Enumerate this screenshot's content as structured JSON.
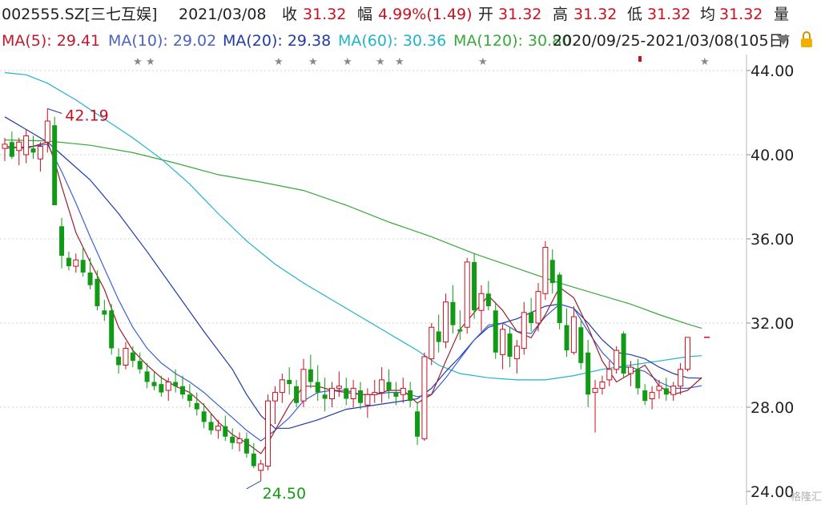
{
  "header": {
    "code": "002555.SZ[三七互娱]",
    "date": "2021/03/08",
    "close_label": "收",
    "close_value": "31.32",
    "change_label": "幅",
    "change_value": "4.99%(1.49)",
    "open_label": "开",
    "open_value": "31.32",
    "high_label": "高",
    "high_value": "31.32",
    "low_label": "低",
    "low_value": "31.32",
    "avg_label": "均",
    "avg_value": "31.32",
    "volume_label": "量"
  },
  "ma_bar": {
    "ma5": "MA(5): 29.41",
    "ma10": "MA(10): 29.02",
    "ma20": "MA(20): 29.38",
    "ma60": "MA(60): 30.36",
    "ma120": "MA(120): 30.80",
    "range": "2020/09/25-2021/03/08(105日)",
    "dropdown_icon": "triangle-down-icon",
    "lock_icon": "lock-icon"
  },
  "colors": {
    "up": "#c8101e",
    "down": "#119a15",
    "ma5": "#9b1f2b",
    "ma10": "#1f3ba8",
    "ma20": "#3c5fd6",
    "ma60": "#22b3c9",
    "ma120": "#38a83a",
    "grid": "#d0d0d0"
  },
  "watermark": "格隆汇",
  "chart_data": {
    "type": "candlestick",
    "title": "",
    "ylim": [
      24,
      44
    ],
    "y_ticks": [
      "44.00",
      "40.00",
      "36.00",
      "32.00",
      "28.00",
      "24.00"
    ],
    "annotations": {
      "high": "42.19",
      "low": "24.50"
    },
    "candles": [
      [
        40.3,
        40.8,
        39.7,
        40.5
      ],
      [
        40.6,
        41.1,
        39.8,
        39.9
      ],
      [
        40.2,
        40.8,
        39.5,
        40.6
      ],
      [
        40.0,
        41.2,
        39.6,
        40.9
      ],
      [
        40.3,
        40.9,
        39.8,
        40.1
      ],
      [
        39.8,
        40.6,
        39.2,
        40.4
      ],
      [
        40.6,
        42.19,
        40.1,
        41.6
      ],
      [
        41.4,
        41.8,
        37.8,
        37.6
      ],
      [
        36.6,
        37.0,
        34.6,
        35.2
      ],
      [
        35.1,
        35.4,
        34.5,
        34.7
      ],
      [
        34.7,
        35.3,
        34.4,
        35.0
      ],
      [
        35.0,
        35.6,
        34.2,
        34.4
      ],
      [
        34.4,
        35.1,
        33.6,
        33.8
      ],
      [
        34.1,
        34.5,
        32.6,
        32.8
      ],
      [
        32.6,
        33.1,
        32.1,
        32.4
      ],
      [
        32.6,
        32.9,
        30.5,
        30.8
      ],
      [
        30.4,
        30.8,
        29.6,
        30.0
      ],
      [
        30.0,
        31.1,
        29.8,
        30.8
      ],
      [
        30.6,
        30.9,
        29.9,
        30.2
      ],
      [
        30.2,
        30.6,
        29.6,
        29.8
      ],
      [
        29.7,
        30.1,
        28.9,
        29.2
      ],
      [
        29.2,
        29.7,
        28.8,
        29.0
      ],
      [
        29.1,
        29.5,
        28.5,
        28.7
      ],
      [
        28.8,
        29.4,
        28.3,
        29.2
      ],
      [
        29.2,
        29.8,
        28.7,
        29.0
      ],
      [
        29.0,
        29.5,
        28.4,
        28.6
      ],
      [
        28.6,
        29.1,
        28.0,
        28.3
      ],
      [
        28.2,
        28.7,
        27.6,
        27.9
      ],
      [
        27.8,
        28.2,
        27.0,
        27.3
      ],
      [
        27.3,
        27.7,
        26.7,
        26.9
      ],
      [
        26.9,
        27.4,
        26.5,
        27.1
      ],
      [
        27.1,
        27.6,
        26.4,
        26.6
      ],
      [
        26.6,
        27.0,
        26.0,
        26.3
      ],
      [
        26.3,
        26.8,
        25.9,
        26.5
      ],
      [
        26.5,
        26.8,
        25.6,
        25.8
      ],
      [
        25.8,
        26.3,
        25.1,
        25.2
      ],
      [
        25.0,
        25.5,
        24.5,
        25.3
      ],
      [
        25.2,
        28.6,
        25.0,
        28.3
      ],
      [
        28.3,
        29.0,
        27.2,
        28.7
      ],
      [
        28.7,
        29.6,
        28.2,
        29.3
      ],
      [
        29.3,
        29.9,
        28.6,
        29.1
      ],
      [
        29.0,
        29.3,
        28.0,
        28.2
      ],
      [
        28.3,
        30.3,
        28.0,
        29.8
      ],
      [
        29.8,
        30.5,
        28.9,
        29.2
      ],
      [
        29.2,
        30.0,
        28.3,
        28.7
      ],
      [
        28.6,
        29.4,
        27.8,
        28.4
      ],
      [
        28.4,
        29.2,
        28.0,
        28.9
      ],
      [
        28.9,
        29.7,
        28.5,
        29.0
      ],
      [
        28.9,
        29.4,
        28.1,
        28.4
      ],
      [
        28.4,
        29.3,
        28.0,
        28.9
      ],
      [
        28.8,
        29.2,
        27.9,
        28.2
      ],
      [
        28.1,
        28.9,
        27.5,
        28.6
      ],
      [
        28.6,
        29.3,
        28.2,
        28.7
      ],
      [
        28.7,
        29.9,
        28.2,
        29.3
      ],
      [
        29.2,
        29.8,
        28.4,
        28.8
      ],
      [
        28.7,
        29.2,
        28.1,
        28.5
      ],
      [
        28.6,
        29.4,
        28.2,
        28.9
      ],
      [
        28.8,
        29.2,
        28.0,
        28.3
      ],
      [
        27.8,
        28.2,
        26.2,
        26.6
      ],
      [
        26.5,
        30.6,
        26.4,
        30.4
      ],
      [
        30.3,
        32.0,
        30.0,
        31.8
      ],
      [
        31.6,
        32.4,
        30.6,
        31.1
      ],
      [
        31.1,
        33.4,
        30.8,
        33.0
      ],
      [
        33.0,
        33.8,
        31.5,
        31.9
      ],
      [
        31.7,
        32.6,
        31.2,
        31.6
      ],
      [
        31.8,
        35.1,
        31.5,
        34.9
      ],
      [
        34.9,
        35.3,
        32.2,
        32.6
      ],
      [
        32.6,
        33.8,
        31.6,
        33.4
      ],
      [
        33.4,
        34.0,
        32.6,
        32.8
      ],
      [
        32.6,
        33.0,
        30.3,
        30.6
      ],
      [
        30.5,
        32.0,
        29.8,
        31.7
      ],
      [
        31.5,
        31.8,
        29.9,
        30.4
      ],
      [
        30.3,
        31.2,
        29.6,
        30.9
      ],
      [
        30.8,
        33.0,
        30.5,
        32.5
      ],
      [
        32.5,
        33.2,
        31.6,
        32.0
      ],
      [
        32.0,
        33.9,
        31.6,
        33.5
      ],
      [
        33.4,
        35.9,
        33.1,
        35.6
      ],
      [
        35.0,
        35.5,
        33.4,
        33.9
      ],
      [
        34.3,
        34.4,
        31.7,
        32.0
      ],
      [
        31.9,
        32.7,
        30.4,
        30.7
      ],
      [
        30.6,
        32.8,
        30.5,
        32.3
      ],
      [
        31.8,
        32.1,
        29.8,
        30.1
      ],
      [
        30.6,
        31.2,
        28.0,
        28.6
      ],
      [
        28.7,
        29.3,
        26.8,
        28.9
      ],
      [
        28.9,
        29.5,
        28.6,
        29.2
      ],
      [
        29.3,
        30.2,
        29.0,
        29.8
      ],
      [
        29.8,
        30.9,
        29.6,
        30.7
      ],
      [
        31.5,
        31.6,
        29.4,
        29.6
      ],
      [
        29.6,
        30.2,
        29.0,
        29.9
      ],
      [
        29.8,
        30.3,
        28.6,
        28.9
      ],
      [
        28.8,
        29.1,
        28.1,
        28.3
      ],
      [
        28.4,
        29.0,
        27.9,
        28.7
      ],
      [
        28.8,
        29.3,
        28.4,
        29.0
      ],
      [
        28.9,
        29.4,
        28.3,
        28.6
      ],
      [
        28.6,
        29.2,
        28.3,
        29.0
      ],
      [
        29.0,
        30.1,
        28.6,
        29.8
      ],
      [
        29.8,
        31.32,
        29.7,
        31.32
      ]
    ],
    "ma120_last": 31.32,
    "ma_series": {
      "MA60": [
        [
          0,
          43.9
        ],
        [
          3,
          43.8
        ],
        [
          6,
          43.4
        ],
        [
          10,
          42.6
        ],
        [
          14,
          41.7
        ],
        [
          18,
          40.8
        ],
        [
          22,
          39.8
        ],
        [
          26,
          38.6
        ],
        [
          30,
          37.2
        ],
        [
          34,
          35.9
        ],
        [
          38,
          34.8
        ],
        [
          42,
          33.9
        ],
        [
          46,
          33.1
        ],
        [
          50,
          32.3
        ],
        [
          54,
          31.5
        ],
        [
          58,
          30.7
        ],
        [
          61,
          30.0
        ],
        [
          64,
          29.6
        ],
        [
          68,
          29.4
        ],
        [
          72,
          29.3
        ],
        [
          76,
          29.3
        ],
        [
          80,
          29.5
        ],
        [
          84,
          29.8
        ],
        [
          88,
          30.0
        ],
        [
          92,
          30.2
        ],
        [
          96,
          30.4
        ],
        [
          98,
          30.45
        ]
      ],
      "MA120": [
        [
          0,
          40.7
        ],
        [
          6,
          40.65
        ],
        [
          12,
          40.45
        ],
        [
          18,
          40.1
        ],
        [
          24,
          39.6
        ],
        [
          30,
          39.05
        ],
        [
          36,
          38.7
        ],
        [
          42,
          38.3
        ],
        [
          48,
          37.6
        ],
        [
          54,
          36.8
        ],
        [
          60,
          36.1
        ],
        [
          66,
          35.3
        ],
        [
          72,
          34.6
        ],
        [
          78,
          33.9
        ],
        [
          84,
          33.3
        ],
        [
          88,
          32.9
        ],
        [
          92,
          32.4
        ],
        [
          96,
          31.95
        ],
        [
          98,
          31.75
        ]
      ],
      "MA20": [
        [
          0,
          41.8
        ],
        [
          3,
          41.2
        ],
        [
          6,
          40.6
        ],
        [
          8,
          40.0
        ],
        [
          12,
          38.8
        ],
        [
          16,
          37.2
        ],
        [
          20,
          35.4
        ],
        [
          24,
          33.5
        ],
        [
          28,
          31.6
        ],
        [
          32,
          29.8
        ],
        [
          34,
          28.6
        ],
        [
          36,
          27.6
        ],
        [
          38,
          27.0
        ],
        [
          40,
          27.0
        ],
        [
          44,
          27.4
        ],
        [
          48,
          27.9
        ],
        [
          52,
          28.1
        ],
        [
          56,
          28.3
        ],
        [
          58,
          28.4
        ],
        [
          60,
          28.9
        ],
        [
          62,
          29.7
        ],
        [
          64,
          30.4
        ],
        [
          66,
          31.2
        ],
        [
          68,
          31.8
        ],
        [
          70,
          32.0
        ],
        [
          72,
          32.2
        ],
        [
          74,
          32.5
        ],
        [
          76,
          32.8
        ],
        [
          78,
          32.9
        ],
        [
          80,
          32.7
        ],
        [
          82,
          32.0
        ],
        [
          84,
          31.2
        ],
        [
          86,
          30.6
        ],
        [
          88,
          30.5
        ],
        [
          90,
          30.3
        ],
        [
          92,
          29.9
        ],
        [
          94,
          29.6
        ],
        [
          96,
          29.4
        ],
        [
          98,
          29.38
        ]
      ],
      "MA10": [
        [
          0,
          40.3
        ],
        [
          4,
          40.4
        ],
        [
          6,
          40.5
        ],
        [
          8,
          39.2
        ],
        [
          10,
          37.7
        ],
        [
          12,
          36.1
        ],
        [
          14,
          34.6
        ],
        [
          16,
          33.1
        ],
        [
          18,
          31.8
        ],
        [
          20,
          30.8
        ],
        [
          22,
          30.1
        ],
        [
          24,
          29.6
        ],
        [
          26,
          29.2
        ],
        [
          28,
          28.7
        ],
        [
          30,
          28.1
        ],
        [
          32,
          27.5
        ],
        [
          34,
          26.9
        ],
        [
          36,
          26.4
        ],
        [
          38,
          26.9
        ],
        [
          40,
          27.5
        ],
        [
          42,
          28.3
        ],
        [
          44,
          28.7
        ],
        [
          46,
          28.8
        ],
        [
          48,
          28.8
        ],
        [
          50,
          28.6
        ],
        [
          52,
          28.6
        ],
        [
          54,
          28.7
        ],
        [
          56,
          28.7
        ],
        [
          58,
          28.5
        ],
        [
          60,
          28.6
        ],
        [
          62,
          29.4
        ],
        [
          64,
          30.3
        ],
        [
          66,
          31.2
        ],
        [
          68,
          31.9
        ],
        [
          70,
          32.0
        ],
        [
          72,
          31.6
        ],
        [
          74,
          31.5
        ],
        [
          76,
          32.3
        ],
        [
          78,
          32.9
        ],
        [
          80,
          32.7
        ],
        [
          82,
          31.6
        ],
        [
          84,
          30.6
        ],
        [
          86,
          29.9
        ],
        [
          88,
          29.9
        ],
        [
          90,
          29.7
        ],
        [
          92,
          29.2
        ],
        [
          94,
          28.9
        ],
        [
          96,
          28.9
        ],
        [
          98,
          29.02
        ]
      ],
      "MA5": [
        [
          0,
          40.4
        ],
        [
          3,
          40.3
        ],
        [
          6,
          40.6
        ],
        [
          7,
          39.7
        ],
        [
          8,
          38.5
        ],
        [
          10,
          36.3
        ],
        [
          12,
          34.9
        ],
        [
          14,
          33.6
        ],
        [
          16,
          31.8
        ],
        [
          18,
          30.7
        ],
        [
          20,
          30.0
        ],
        [
          22,
          29.4
        ],
        [
          24,
          29.0
        ],
        [
          26,
          28.7
        ],
        [
          28,
          28.1
        ],
        [
          30,
          27.3
        ],
        [
          32,
          26.7
        ],
        [
          34,
          26.3
        ],
        [
          36,
          25.8
        ],
        [
          37,
          26.3
        ],
        [
          38,
          26.9
        ],
        [
          40,
          28.1
        ],
        [
          42,
          29.0
        ],
        [
          44,
          29.0
        ],
        [
          46,
          28.8
        ],
        [
          48,
          28.7
        ],
        [
          50,
          28.6
        ],
        [
          52,
          28.6
        ],
        [
          54,
          28.8
        ],
        [
          56,
          28.8
        ],
        [
          58,
          28.2
        ],
        [
          60,
          28.6
        ],
        [
          62,
          30.2
        ],
        [
          64,
          31.7
        ],
        [
          66,
          32.5
        ],
        [
          68,
          33.3
        ],
        [
          70,
          32.6
        ],
        [
          72,
          31.6
        ],
        [
          74,
          31.3
        ],
        [
          76,
          32.4
        ],
        [
          78,
          33.7
        ],
        [
          80,
          33.2
        ],
        [
          82,
          31.8
        ],
        [
          84,
          30.2
        ],
        [
          86,
          29.2
        ],
        [
          88,
          29.6
        ],
        [
          90,
          30.0
        ],
        [
          92,
          29.0
        ],
        [
          94,
          28.6
        ],
        [
          96,
          28.8
        ],
        [
          98,
          29.41
        ]
      ]
    }
  }
}
